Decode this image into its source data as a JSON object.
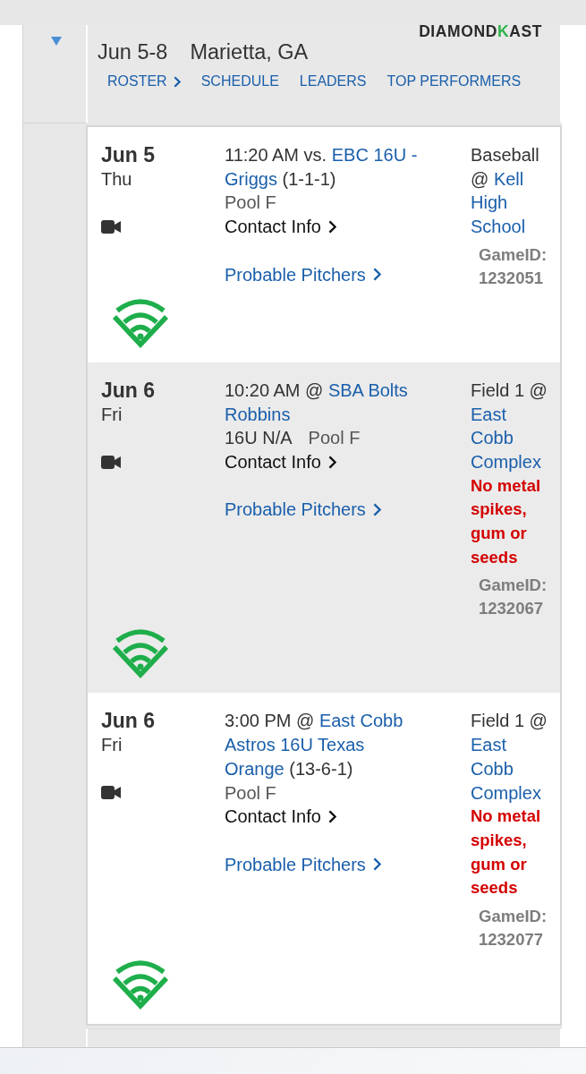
{
  "header": {
    "expanded": true,
    "logo": [
      {
        "text": "DIAMOND",
        "accent": false
      },
      {
        "text": "K",
        "accent": true
      },
      {
        "text": "AST",
        "accent": false
      }
    ],
    "dates": "Jun 5-8",
    "location": "Marietta, GA",
    "links": [
      {
        "label": "ROSTER",
        "chevron": true
      },
      {
        "label": "SCHEDULE",
        "chevron": false
      },
      {
        "label": "LEADERS",
        "chevron": false
      },
      {
        "label": "TOP PERFORMERS",
        "chevron": false
      }
    ]
  },
  "games": [
    {
      "date": "Jun 5",
      "day": "Thu",
      "matchup": [
        {
          "kind": "time",
          "text": "11:20 AM vs."
        },
        {
          "kind": "team",
          "text": "EBC 16U -"
        },
        {
          "kind": "team",
          "text": "Griggs"
        },
        {
          "kind": "record",
          "text": "(1-1-1)"
        }
      ],
      "details": [
        {
          "kind": "pool",
          "text": "Pool F"
        }
      ],
      "contact": "Contact Info",
      "pitchers": "Probable Pitchers",
      "venue": [
        {
          "kind": "field",
          "text": "Baseball"
        },
        {
          "kind": "field",
          "text": "@"
        },
        {
          "kind": "site",
          "text": "Kell"
        },
        {
          "kind": "site",
          "text": "High"
        },
        {
          "kind": "site",
          "text": "School"
        }
      ],
      "game_id_label": "GameID:",
      "game_id": "1232051"
    },
    {
      "date": "Jun 6",
      "day": "Fri",
      "matchup": [
        {
          "kind": "time",
          "text": "10:20 AM @"
        },
        {
          "kind": "team",
          "text": "SBA Bolts"
        },
        {
          "kind": "team",
          "text": "Robbins"
        }
      ],
      "details": [
        {
          "kind": "division",
          "text": "16U N/A"
        },
        {
          "kind": "pool",
          "text": "Pool F"
        }
      ],
      "contact": "Contact Info",
      "pitchers": "Probable Pitchers",
      "venue": [
        {
          "kind": "field",
          "text": "Field 1 @"
        },
        {
          "kind": "site",
          "text": "East"
        },
        {
          "kind": "site",
          "text": "Cobb"
        },
        {
          "kind": "site",
          "text": "Complex"
        }
      ],
      "note": "No metal spikes, gum or seeds",
      "game_id_label": "GameID:",
      "game_id": "1232067"
    },
    {
      "date": "Jun 6",
      "day": "Fri",
      "matchup": [
        {
          "kind": "time",
          "text": "3:00 PM @"
        },
        {
          "kind": "team",
          "text": "East Cobb"
        },
        {
          "kind": "team",
          "text": "Astros 16U Texas"
        },
        {
          "kind": "team",
          "text": "Orange"
        },
        {
          "kind": "record",
          "text": "(13-6-1)"
        }
      ],
      "details": [
        {
          "kind": "pool",
          "text": "Pool F"
        }
      ],
      "contact": "Contact Info",
      "pitchers": "Probable Pitchers",
      "venue": [
        {
          "kind": "field",
          "text": "Field 1 @"
        },
        {
          "kind": "site",
          "text": "East"
        },
        {
          "kind": "site",
          "text": "Cobb"
        },
        {
          "kind": "site",
          "text": "Complex"
        }
      ],
      "note": "No metal spikes, gum or seeds",
      "game_id_label": "GameID:",
      "game_id": "1232077"
    }
  ]
}
